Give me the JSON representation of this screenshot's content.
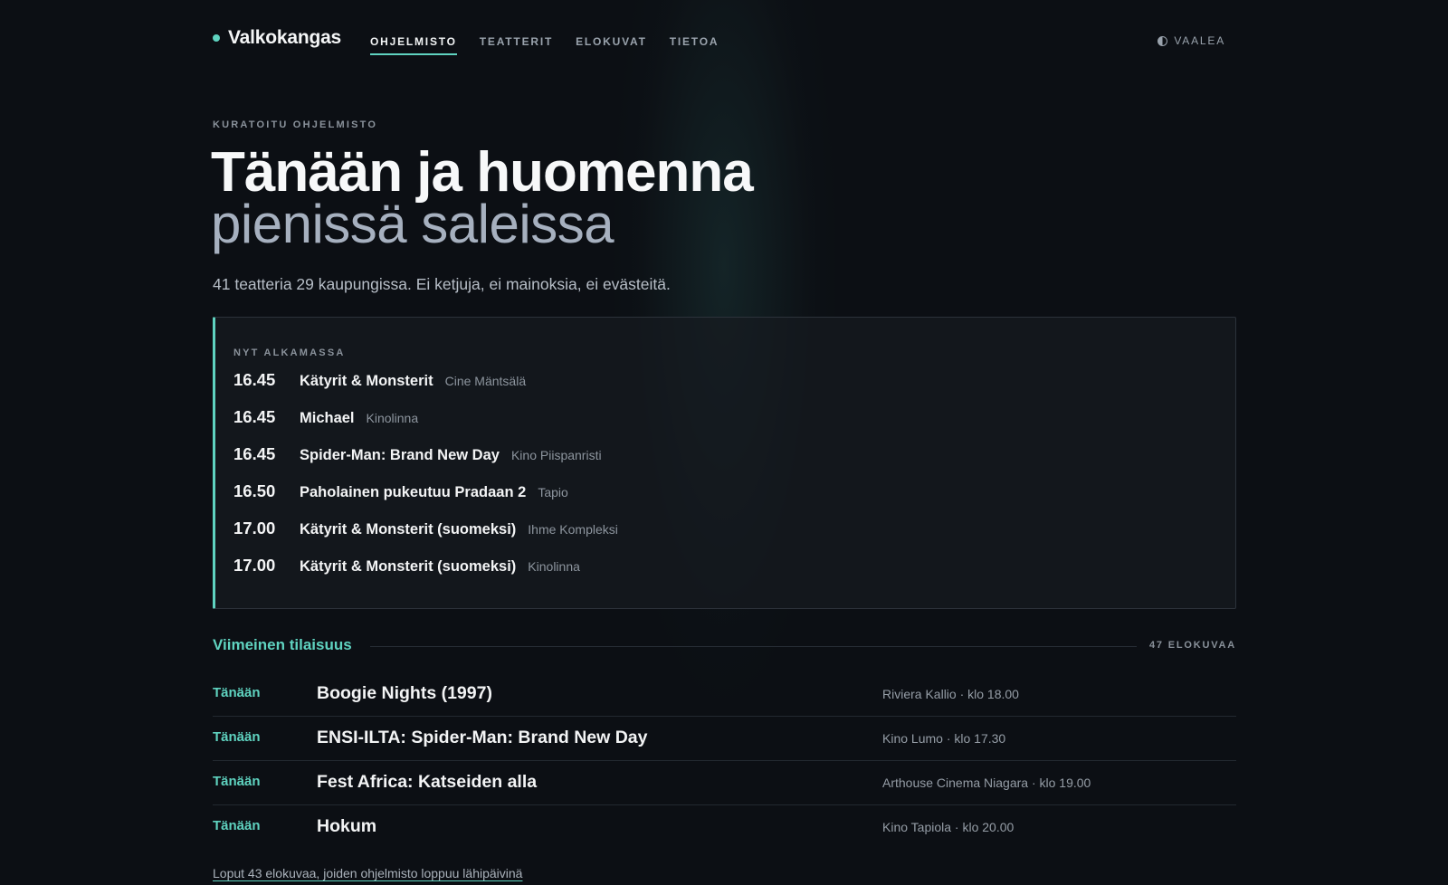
{
  "header": {
    "brand": "Valkokangas",
    "nav": [
      {
        "label": "OHJELMISTO",
        "active": true
      },
      {
        "label": "TEATTERIT",
        "active": false
      },
      {
        "label": "ELOKUVAT",
        "active": false
      },
      {
        "label": "TIETOA",
        "active": false
      }
    ],
    "theme_toggle": "VAALEA",
    "theme_icon": "half-circle-icon"
  },
  "hero": {
    "eyebrow": "KURATOITU OHJELMISTO",
    "title": "Tänään ja huomenna",
    "subtitle": "pienissä saleissa",
    "lede": "41 teatteria 29 kaupungissa. Ei ketjuja, ei mainoksia, ei evästeitä."
  },
  "now_starting": {
    "label": "NYT ALKAMASSA",
    "shows": [
      {
        "time": "16.45",
        "title": "Kätyrit & Monsterit",
        "venue": "Cine Mäntsälä"
      },
      {
        "time": "16.45",
        "title": "Michael",
        "venue": "Kinolinna"
      },
      {
        "time": "16.45",
        "title": "Spider-Man: Brand New Day",
        "venue": "Kino Piispanristi"
      },
      {
        "time": "16.50",
        "title": "Paholainen pukeutuu Pradaan 2",
        "venue": "Tapio"
      },
      {
        "time": "17.00",
        "title": "Kätyrit & Monsterit (suomeksi)",
        "venue": "Ihme Kompleksi"
      },
      {
        "time": "17.00",
        "title": "Kätyrit & Monsterit (suomeksi)",
        "venue": "Kinolinna"
      }
    ]
  },
  "last_chance": {
    "title": "Viimeinen tilaisuus",
    "count": "47 ELOKUVAA",
    "rows": [
      {
        "when": "Tänään",
        "title": "Boogie Nights (1997)",
        "venue": "Riviera Kallio · klo 18.00"
      },
      {
        "when": "Tänään",
        "title": "ENSI-ILTA: Spider-Man: Brand New Day",
        "venue": "Kino Lumo · klo 17.30"
      },
      {
        "when": "Tänään",
        "title": "Fest Africa: Katseiden alla",
        "venue": "Arthouse Cinema Niagara · klo 19.00"
      },
      {
        "when": "Tänään",
        "title": "Hokum",
        "venue": "Kino Tapiola · klo 20.00"
      }
    ],
    "more_link": "Loput 43 elokuvaa, joiden ohjelmisto loppuu lähipäivinä"
  },
  "colors": {
    "accent": "#5fd3c0",
    "background": "#0c0f14"
  }
}
